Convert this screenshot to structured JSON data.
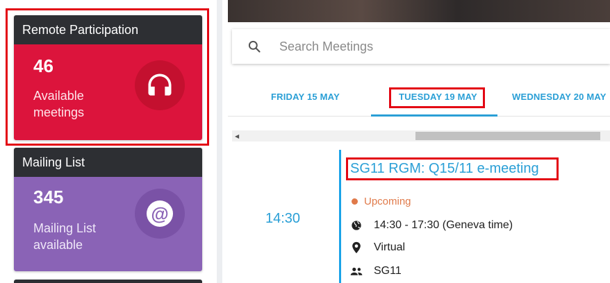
{
  "remote_card": {
    "title": "Remote Participation",
    "count": "46",
    "description": "Available meetings",
    "icon": "headphones-icon",
    "color": "#dc143c"
  },
  "mail_card": {
    "title": "Mailing List",
    "count": "345",
    "description": "Mailing List available",
    "icon": "at-sign-icon",
    "color": "#8a63b6"
  },
  "search": {
    "placeholder": "Search Meetings",
    "icon": "search-icon"
  },
  "tabs": [
    {
      "label": "FRIDAY 15 MAY",
      "active": false
    },
    {
      "label": "TUESDAY 19 MAY",
      "active": true
    },
    {
      "label": "WEDNESDAY 20 MAY",
      "active": false
    }
  ],
  "meeting": {
    "time": "14:30",
    "title": "SG11 RGM: Q15/11 e-meeting",
    "status": "Upcoming",
    "schedule": "14:30 - 17:30 (Geneva time)",
    "location": "Virtual",
    "group": "SG11"
  },
  "colors": {
    "accent": "#2a9fd6",
    "status_upcoming": "#e07a4a",
    "highlight": "#e30613"
  }
}
